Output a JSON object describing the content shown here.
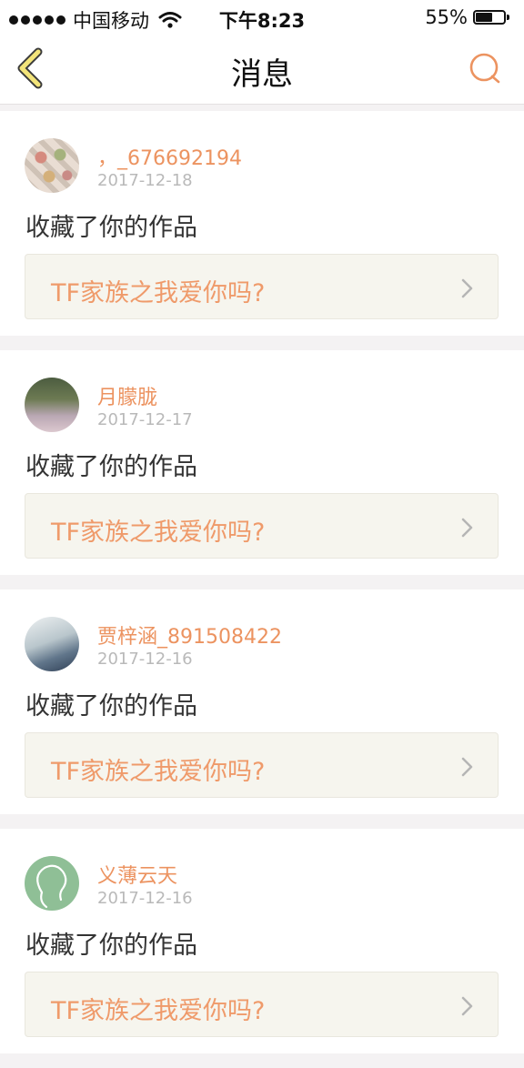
{
  "status_bar": {
    "carrier": "中国移动",
    "time": "下午8:23",
    "battery": "55%",
    "icons": [
      "signal-dots-icon",
      "wifi-icon",
      "battery-icon"
    ]
  },
  "nav": {
    "title": "消息",
    "back_icon": "chevron-left-icon",
    "search_icon": "search-icon",
    "accent": "#ec9360"
  },
  "messages": [
    {
      "username": "，_676692194",
      "date": "2017-12-18",
      "action": "收藏了你的作品",
      "work_title": "TF家族之我爱你吗?"
    },
    {
      "username": "月朦胧",
      "date": "2017-12-17",
      "action": "收藏了你的作品",
      "work_title": "TF家族之我爱你吗?"
    },
    {
      "username": "贾梓涵_891508422",
      "date": "2017-12-16",
      "action": "收藏了你的作品",
      "work_title": "TF家族之我爱你吗?"
    },
    {
      "username": "义薄云天",
      "date": "2017-12-16",
      "action": "收藏了你的作品",
      "work_title": "TF家族之我爱你吗?"
    }
  ]
}
